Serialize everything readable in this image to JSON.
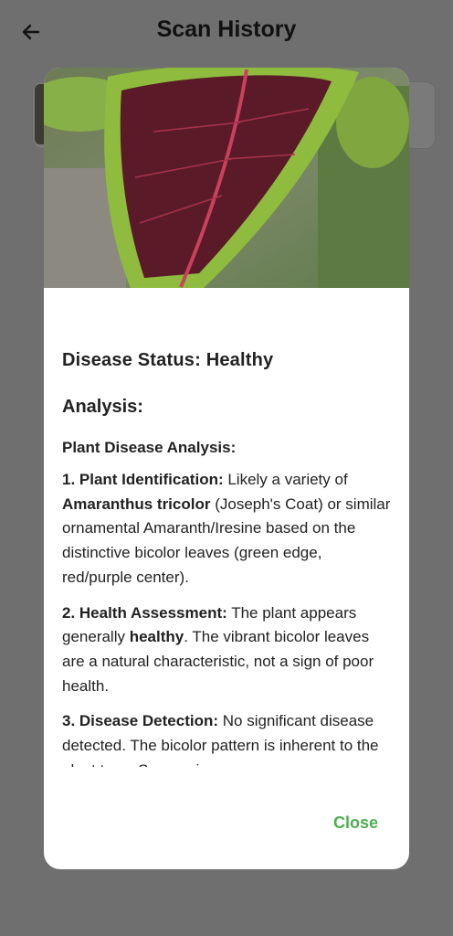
{
  "appbar": {
    "title": "Scan History",
    "back_icon": "arrow-left-icon"
  },
  "dialog": {
    "image_icon": "leaf-photo",
    "status_line": "Disease Status: Healthy",
    "analysis_heading": "Analysis:",
    "report_heading": "Plant Disease Analysis:",
    "sections": [
      {
        "label": "1. Plant Identification:",
        "text_a": " Likely a variety of ",
        "bold_b": "Amaranthus tricolor",
        "text_c": " (Joseph's Coat) or similar ornamental Amaranth/Iresine based on the distinctive bicolor leaves (green edge, red/purple center)."
      },
      {
        "label": "2. Health Assessment:",
        "text_a": " The plant appears generally ",
        "bold_b": "healthy",
        "text_c": ". The vibrant bicolor leaves are a natural characteristic, not a sign of poor health."
      },
      {
        "label": "3. Disease Detection:",
        "text_a": " No significant disease detected. The bicolor pattern is inherent to the plant type. Some minor",
        "bold_b": "",
        "text_c": ""
      }
    ],
    "close_label": "Close",
    "accent_color": "#4caf50"
  }
}
